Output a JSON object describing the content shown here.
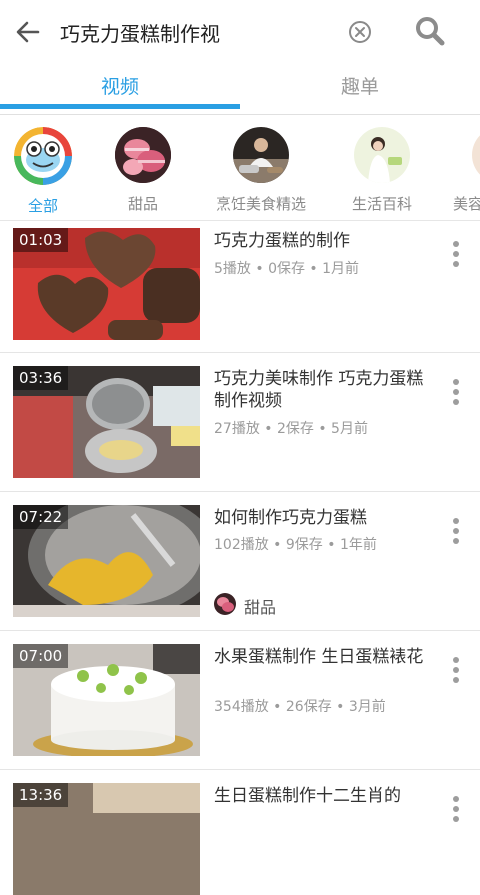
{
  "search": {
    "query": "巧克力蛋糕制作视"
  },
  "tabs": [
    {
      "label": "视频"
    },
    {
      "label": "趣单"
    }
  ],
  "categories": [
    {
      "label": "全部",
      "icon": "frog-app-icon"
    },
    {
      "label": "甜品",
      "icon": "macaron-icon"
    },
    {
      "label": "烹饪美食精选",
      "icon": "cooking-icon"
    },
    {
      "label": "生活百科",
      "icon": "woman-icon"
    },
    {
      "label": "美容"
    }
  ],
  "videos": [
    {
      "duration": "01:03",
      "title": "巧克力蛋糕的制作",
      "meta": "5播放 • 0保存 • 1月前"
    },
    {
      "duration": "03:36",
      "title": "巧克力美味制作 巧克力蛋糕制作视频",
      "meta": "27播放 • 2保存 • 5月前"
    },
    {
      "duration": "07:22",
      "title": "如何制作巧克力蛋糕",
      "meta": "102播放 • 9保存 • 1年前",
      "tag": "甜品"
    },
    {
      "duration": "07:00",
      "title": "水果蛋糕制作 生日蛋糕裱花",
      "meta": "354播放 • 26保存 • 3月前"
    },
    {
      "duration": "13:36",
      "title": "生日蛋糕制作十二生肖的"
    }
  ],
  "colors": {
    "accent": "#2a9fe3"
  }
}
